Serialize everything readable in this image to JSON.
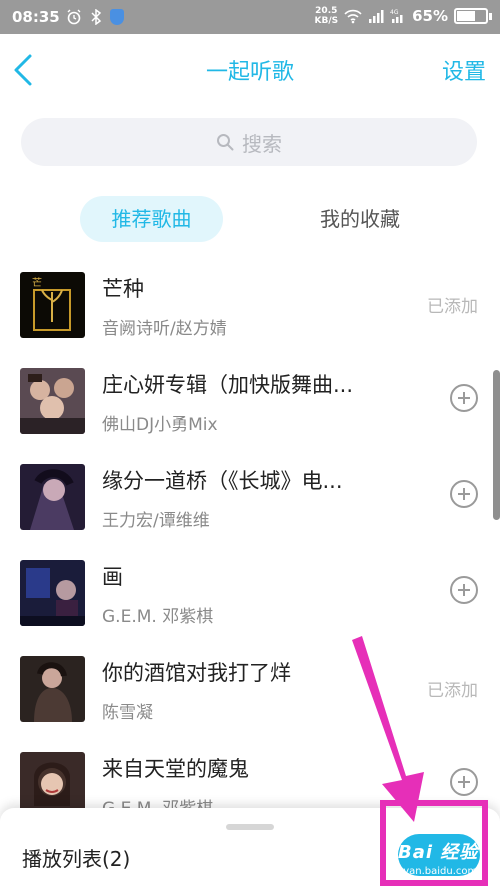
{
  "status_bar": {
    "time": "08:35",
    "net_speed": "20.5",
    "net_unit": "KB/S",
    "battery": "65%",
    "battery_level": 0.65
  },
  "header": {
    "title": "一起听歌",
    "settings_label": "设置"
  },
  "search": {
    "placeholder": "搜索"
  },
  "tabs": {
    "active": "推荐歌曲",
    "other": "我的收藏"
  },
  "songs": [
    {
      "title": "芒种",
      "artist": "音阙诗听/赵方婧",
      "status": "已添加"
    },
    {
      "title": "庄心妍专辑（加快版舞曲...",
      "artist": "佛山DJ小勇Mix",
      "status": "add"
    },
    {
      "title": "缘分一道桥（《长城》电...",
      "artist": "王力宏/谭维维",
      "status": "add"
    },
    {
      "title": "画",
      "artist": "G.E.M. 邓紫棋",
      "status": "add"
    },
    {
      "title": "你的酒馆对我打了烊",
      "artist": "陈雪凝",
      "status": "已添加"
    },
    {
      "title": "来自天堂的魔鬼",
      "artist": "G.E.M. 邓紫棋",
      "status": "add"
    }
  ],
  "bottom_bar": {
    "playlist_label": "播放列表(2)"
  },
  "watermark": {
    "brand": "Bai 经验",
    "url": "jingyan.baidu.com"
  },
  "colors": {
    "accent": "#21b8e6",
    "annotation": "#e62fb8"
  }
}
